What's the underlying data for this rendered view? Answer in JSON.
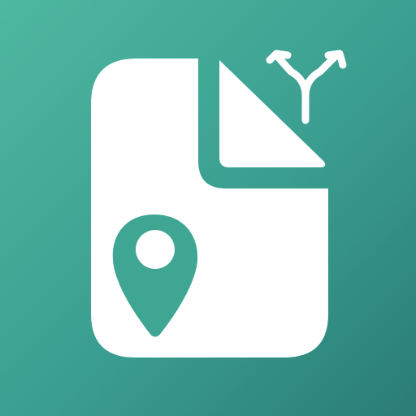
{
  "icon": {
    "subject": "file-with-location-pin-and-split-arrows",
    "background_gradient": [
      "#4fb8a0",
      "#3a9e90",
      "#2a7d74"
    ],
    "foreground_color": "#ffffff",
    "pin_color": "#3fa693",
    "glyphs": [
      "document-icon",
      "map-pin-icon",
      "split-arrow-icon"
    ]
  }
}
